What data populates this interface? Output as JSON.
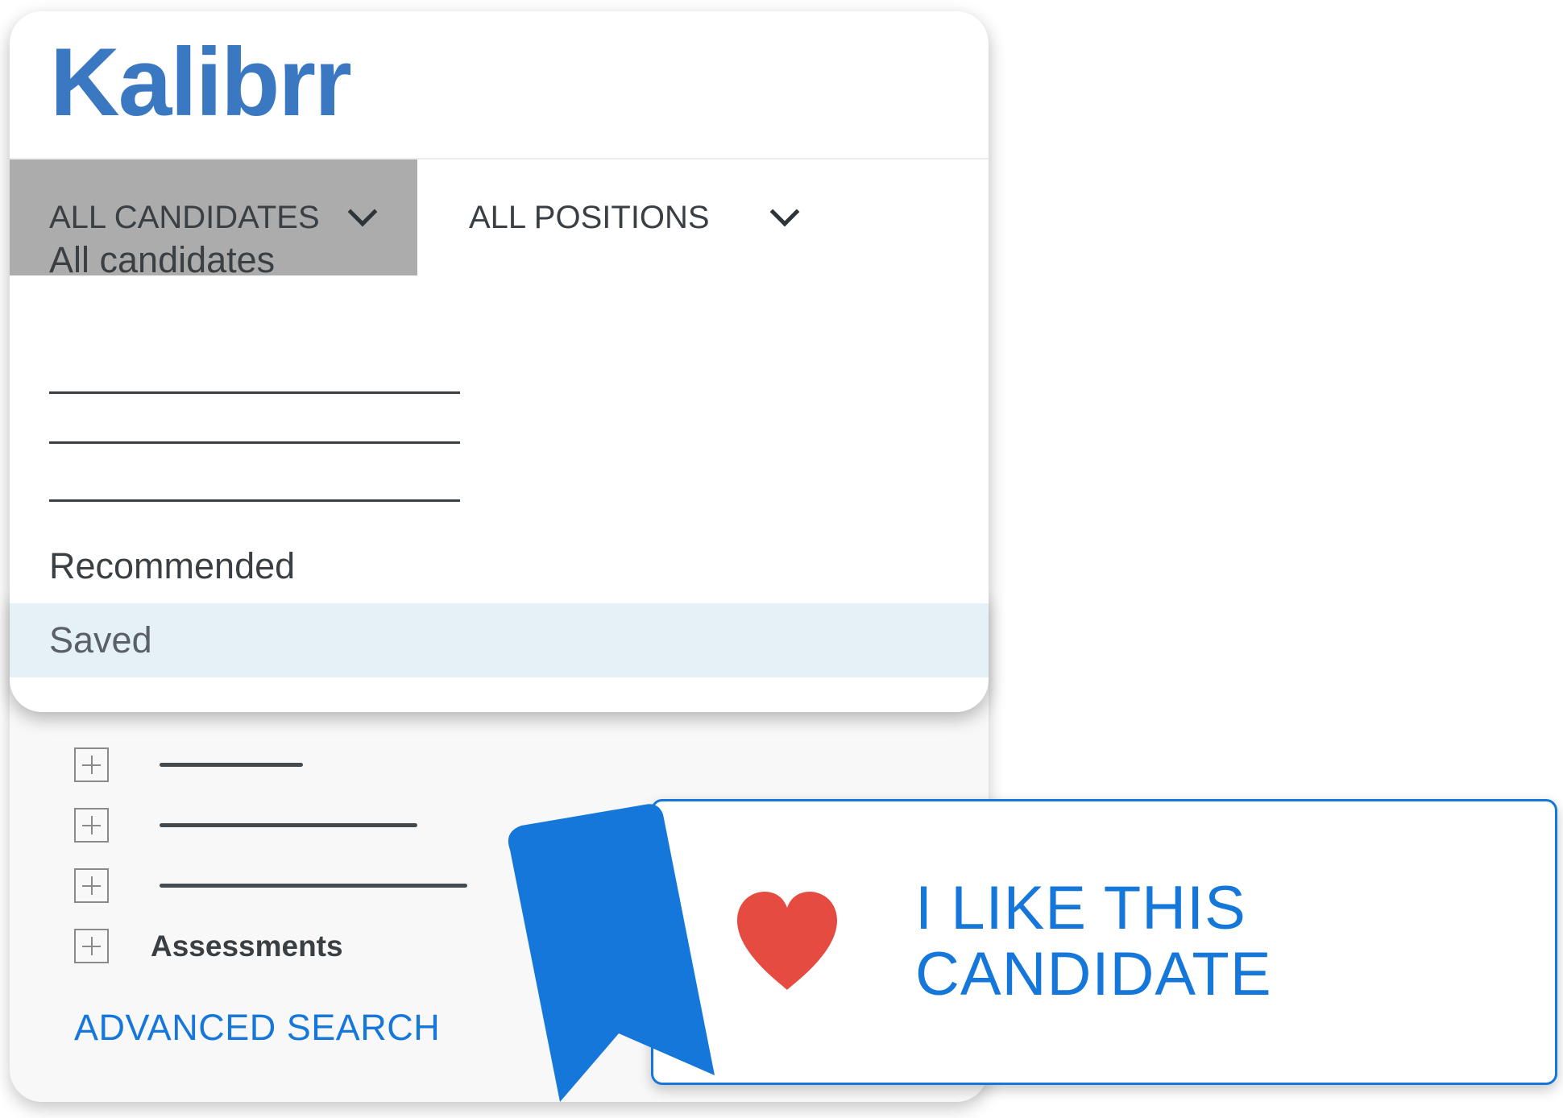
{
  "brand": {
    "logo_text": "Kalibrr",
    "color": "#3a78c2"
  },
  "tabs": {
    "candidates": {
      "label": "ALL CANDIDATES",
      "selected": true
    },
    "positions": {
      "label": "ALL POSITIONS",
      "selected": false
    }
  },
  "dropdown": {
    "items": [
      {
        "label": "All candidates"
      },
      {
        "label": "Recommended"
      },
      {
        "label": "Saved",
        "highlighted": true
      }
    ],
    "placeholder_line_count": 3
  },
  "filters": {
    "items": [
      {
        "label": ""
      },
      {
        "label": ""
      },
      {
        "label": ""
      },
      {
        "label": "Assessments"
      }
    ],
    "advanced_search_label": "ADVANCED SEARCH"
  },
  "like_callout": {
    "line1": "I LIKE THIS",
    "line2": "CANDIDATE",
    "icon": "heart-icon",
    "ribbon_icon": "bookmark-ribbon-icon"
  },
  "colors": {
    "accent": "#1477d9",
    "heart": "#e54b40",
    "selected_tab": "#acacac",
    "highlight_row": "#e6f0f7"
  }
}
